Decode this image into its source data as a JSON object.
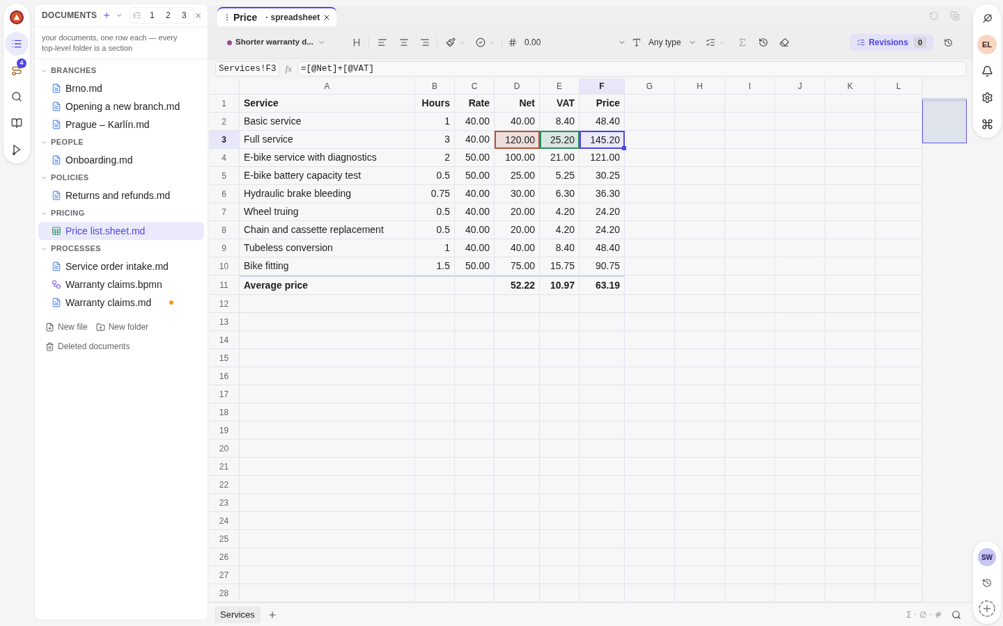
{
  "rail": {
    "items": [
      {
        "selected": true
      },
      {
        "selected": false,
        "badge": "4"
      },
      {
        "selected": false
      },
      {
        "selected": false
      },
      {
        "selected": false
      }
    ]
  },
  "sidebar": {
    "title": "DOCUMENTS",
    "levels": [
      "1",
      "2",
      "3"
    ],
    "description": "your documents, one row each — every top-level folder is a section",
    "sections": [
      {
        "title": "BRANCHES",
        "expanded": true,
        "items": [
          {
            "label": "Brno.md",
            "kind": "document",
            "selected": false,
            "modified": false
          },
          {
            "label": "Opening a new branch.md",
            "kind": "document",
            "selected": false,
            "modified": false
          },
          {
            "label": "Prague – Karlín.md",
            "kind": "document",
            "selected": false,
            "modified": false
          }
        ]
      },
      {
        "title": "PEOPLE",
        "expanded": true,
        "items": [
          {
            "label": "Onboarding.md",
            "kind": "document",
            "selected": false,
            "modified": false
          }
        ]
      },
      {
        "title": "POLICIES",
        "expanded": true,
        "items": [
          {
            "label": "Returns and refunds.md",
            "kind": "document",
            "selected": false,
            "modified": false
          }
        ]
      },
      {
        "title": "PRICING",
        "expanded": true,
        "items": [
          {
            "label": "Price list.sheet.md",
            "kind": "sheet",
            "selected": true,
            "modified": false
          }
        ]
      },
      {
        "title": "PROCESSES",
        "expanded": true,
        "items": [
          {
            "label": "Service order intake.md",
            "kind": "document",
            "selected": false,
            "modified": false
          },
          {
            "label": "Warranty claims.bpmn",
            "kind": "diagram",
            "selected": false,
            "modified": false
          },
          {
            "label": "Warranty claims.md",
            "kind": "document",
            "selected": false,
            "modified": true
          }
        ]
      }
    ],
    "actions": [
      {
        "label": "New file",
        "kind": "file"
      },
      {
        "label": "New folder",
        "kind": "folder"
      }
    ],
    "trash": {
      "label": "Deleted documents"
    }
  },
  "tabs": [
    {
      "title": "Price",
      "subtitle": "· spreadsheet",
      "selected": true
    }
  ],
  "toolbar": {
    "branch": "Shorter warranty d...",
    "number_format": "0.00",
    "cell_type": "Any type",
    "revisions": {
      "label": "Revisions",
      "count": "0"
    }
  },
  "formula_bar": {
    "cell": "Services!F3",
    "fx": "fx",
    "formula": "=[@Net]+[@VAT]"
  },
  "grid": {
    "columns": [
      {
        "label": "A",
        "selected": false
      },
      {
        "label": "B",
        "selected": false
      },
      {
        "label": "C",
        "selected": false
      },
      {
        "label": "D",
        "selected": false
      },
      {
        "label": "E",
        "selected": false
      },
      {
        "label": "F",
        "selected": true
      },
      {
        "label": "G",
        "selected": false
      },
      {
        "label": "H",
        "selected": false
      },
      {
        "label": "I",
        "selected": false
      },
      {
        "label": "J",
        "selected": false
      },
      {
        "label": "K",
        "selected": false
      },
      {
        "label": "L",
        "selected": false
      }
    ],
    "rows": [
      {
        "number": "1",
        "kind": "header",
        "selected": false,
        "cells": {
          "A": "Service",
          "B": "Hours",
          "C": "Rate",
          "D": "Net",
          "E": "VAT",
          "F": "Price"
        }
      },
      {
        "number": "2",
        "kind": "data",
        "selected": false,
        "cells": {
          "A": "Basic service",
          "B": "1",
          "C": "40.00",
          "D": "40.00",
          "E": "8.40",
          "F": "48.40"
        }
      },
      {
        "number": "3",
        "kind": "data",
        "selected": true,
        "cells": {
          "A": "Full service",
          "B": "3",
          "C": "40.00",
          "D": "120.00",
          "E": "25.20",
          "F": "145.20"
        },
        "highlights": {
          "D": {
            "color": "#b3533b"
          },
          "E": {
            "color": "#2e8a66"
          }
        }
      },
      {
        "number": "4",
        "kind": "data",
        "selected": false,
        "cells": {
          "A": "E-bike service with diagnostics",
          "B": "2",
          "C": "50.00",
          "D": "100.00",
          "E": "21.00",
          "F": "121.00"
        }
      },
      {
        "number": "5",
        "kind": "data",
        "selected": false,
        "cells": {
          "A": "E-bike battery capacity test",
          "B": "0.5",
          "C": "50.00",
          "D": "25.00",
          "E": "5.25",
          "F": "30.25"
        }
      },
      {
        "number": "6",
        "kind": "data",
        "selected": false,
        "cells": {
          "A": "Hydraulic brake bleeding",
          "B": "0.75",
          "C": "40.00",
          "D": "30.00",
          "E": "6.30",
          "F": "36.30"
        }
      },
      {
        "number": "7",
        "kind": "data",
        "selected": false,
        "cells": {
          "A": "Wheel truing",
          "B": "0.5",
          "C": "40.00",
          "D": "20.00",
          "E": "4.20",
          "F": "24.20"
        }
      },
      {
        "number": "8",
        "kind": "data",
        "selected": false,
        "cells": {
          "A": "Chain and cassette replacement",
          "B": "0.5",
          "C": "40.00",
          "D": "20.00",
          "E": "4.20",
          "F": "24.20"
        }
      },
      {
        "number": "9",
        "kind": "data",
        "selected": false,
        "cells": {
          "A": "Tubeless conversion",
          "B": "1",
          "C": "40.00",
          "D": "40.00",
          "E": "8.40",
          "F": "48.40"
        }
      },
      {
        "number": "10",
        "kind": "data",
        "selected": false,
        "cells": {
          "A": "Bike fitting",
          "B": "1.5",
          "C": "50.00",
          "D": "75.00",
          "E": "15.75",
          "F": "90.75"
        }
      },
      {
        "number": "11",
        "kind": "total",
        "selected": false,
        "cells": {
          "A": "Average price",
          "D": "52.22",
          "E": "10.97",
          "F": "63.19"
        }
      },
      {
        "number": "12",
        "kind": "empty",
        "selected": false
      },
      {
        "number": "13",
        "kind": "empty",
        "selected": false
      },
      {
        "number": "14",
        "kind": "empty",
        "selected": false
      },
      {
        "number": "15",
        "kind": "empty",
        "selected": false
      },
      {
        "number": "16",
        "kind": "empty",
        "selected": false
      },
      {
        "number": "17",
        "kind": "empty",
        "selected": false
      },
      {
        "number": "18",
        "kind": "empty",
        "selected": false
      },
      {
        "number": "19",
        "kind": "empty",
        "selected": false
      },
      {
        "number": "20",
        "kind": "empty",
        "selected": false
      },
      {
        "number": "21",
        "kind": "empty",
        "selected": false
      },
      {
        "number": "22",
        "kind": "empty",
        "selected": false
      },
      {
        "number": "23",
        "kind": "empty",
        "selected": false
      },
      {
        "number": "24",
        "kind": "empty",
        "selected": false
      },
      {
        "number": "25",
        "kind": "empty",
        "selected": false
      },
      {
        "number": "26",
        "kind": "empty",
        "selected": false
      },
      {
        "number": "27",
        "kind": "empty",
        "selected": false
      },
      {
        "number": "28",
        "kind": "empty",
        "selected": false
      }
    ]
  },
  "sheet_tabs": [
    {
      "label": "Services",
      "selected": true
    }
  ],
  "status_bar": {
    "summary": "Σ · ∅ · #"
  },
  "right_rail": {
    "user": "EL",
    "collaborator": "SW"
  }
}
